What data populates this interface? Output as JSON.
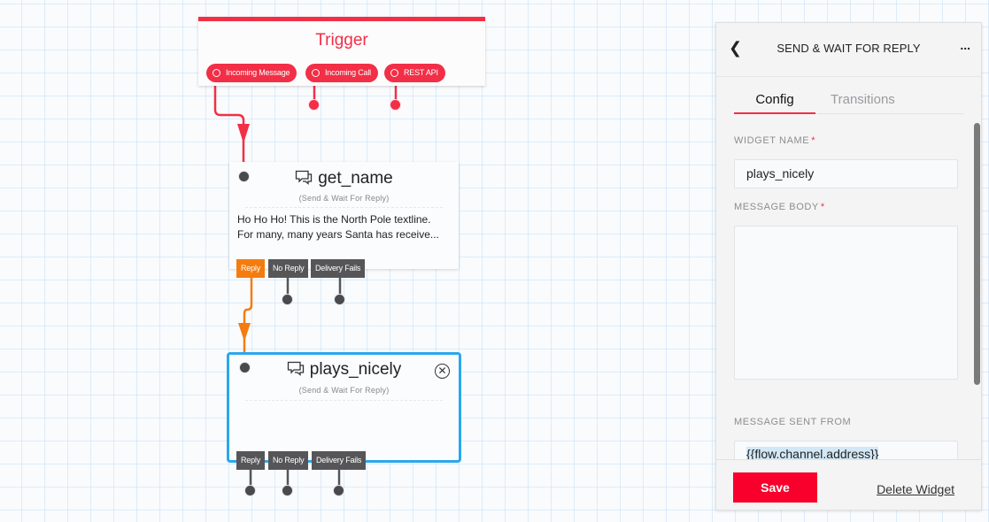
{
  "trigger": {
    "title": "Trigger",
    "color": "#f22f46",
    "outputs": [
      {
        "label": "Incoming Message"
      },
      {
        "label": "Incoming Call"
      },
      {
        "label": "REST API"
      }
    ]
  },
  "widgets": [
    {
      "name": "get_name",
      "type": "(Send & Wait For Reply)",
      "icon": "message-bubbles-icon",
      "body_lines": [
        "Ho Ho Ho! This is the North Pole textline.",
        "For many, many years Santa has receive..."
      ],
      "transitions": [
        {
          "label": "Reply",
          "active": true
        },
        {
          "label": "No Reply",
          "active": false
        },
        {
          "label": "Delivery Fails",
          "active": false
        }
      ]
    },
    {
      "name": "plays_nicely",
      "type": "(Send & Wait For Reply)",
      "icon": "message-bubbles-icon",
      "selected": true,
      "transitions": [
        {
          "label": "Reply",
          "active": false
        },
        {
          "label": "No Reply",
          "active": false
        },
        {
          "label": "Delivery Fails",
          "active": false
        }
      ]
    }
  ],
  "colors": {
    "trigger": "#f22f46",
    "active_transition": "#f47c0f",
    "selected_border": "#2ba7ec",
    "save": "#f8002b"
  },
  "panel": {
    "title": "SEND & WAIT FOR REPLY",
    "back_icon": "chevron-left-icon",
    "more_label": "...",
    "tabs": [
      {
        "label": "Config",
        "active": true
      },
      {
        "label": "Transitions",
        "active": false
      }
    ],
    "fields": {
      "widget_name": {
        "label": "WIDGET NAME",
        "required": "*",
        "value": "plays_nicely"
      },
      "message_body": {
        "label": "MESSAGE BODY",
        "required": "*",
        "value": ""
      },
      "message_sent_from": {
        "label": "MESSAGE SENT FROM",
        "value": "{{flow.channel.address}}"
      }
    },
    "save_label": "Save",
    "delete_label": "Delete Widget"
  }
}
